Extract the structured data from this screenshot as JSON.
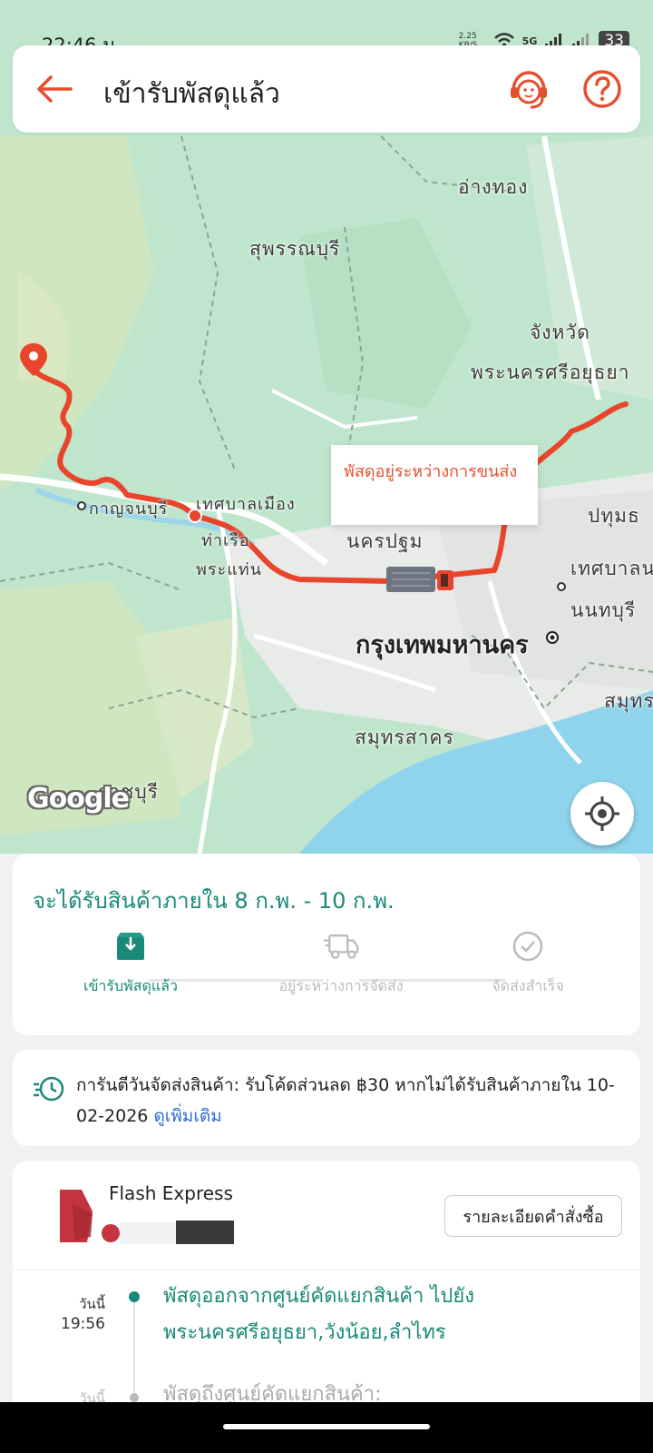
{
  "status_bar": {
    "time": "22:46 น.",
    "net_speed": "2.25 KB/S",
    "network": "5G",
    "battery": "33"
  },
  "header": {
    "title": "เข้ารับพัสดุแล้ว"
  },
  "map": {
    "labels": {
      "angthong": "อ่างทอง",
      "suphanburi": "สุพรรณบุรี",
      "changwat": "จังหวัด",
      "ayutthaya": "พระนครศรีอยุธยา",
      "kanchanaburi": "กาญจนบุรี",
      "thesaban_mueang": "เทศบาลเมือง",
      "tha_ruea": "ท่าเรือ",
      "phra_thaen": "พระแท่น",
      "nakhon_pathom": "นครปฐม",
      "pathum": "ปทุมธ",
      "thesaban_n": "เทศบาลน",
      "nonthaburi": "นนทบุรี",
      "bangkok": "กรุงเทพมหานคร",
      "samut": "สมุทร",
      "samut_sakhon": "สมุทรสาคร",
      "ratchaburi": "ราชบุรี"
    },
    "google_logo": "Google",
    "tooltip": "พัสดุอยู่ระหว่างการขนส่ง",
    "route_color": "#e8452c"
  },
  "delivery": {
    "eta": "จะได้รับสินค้าภายใน 8 ก.พ. - 10 ก.พ.",
    "steps": [
      {
        "label": "เข้ารับพัสดุแล้ว",
        "state": "active"
      },
      {
        "label": "อยู่ระหว่างการจัดส่ง",
        "state": "pending"
      },
      {
        "label": "จัดส่งสำเร็จ",
        "state": "pending"
      }
    ]
  },
  "guarantee": {
    "text": "การันตีวันจัดส่งสินค้า: รับโค้ดส่วนลด ฿30 หากไม่ได้รับสินค้าภายใน 10-02-2026",
    "link": "ดูเพิ่มเติม"
  },
  "tracking": {
    "courier": "Flash Express",
    "order_details_button": "รายละเอียดคำสั่งซื้อ",
    "events": [
      {
        "day": "วันนี้",
        "time": "19:56",
        "description": "พัสดุออกจากศูนย์คัดแยกสินค้า ไปยัง พระนครศรีอยุธยา,วังน้อย,ลำไทร",
        "state": "current"
      },
      {
        "day": "วันนี้",
        "time": "",
        "description": "พัสดุถึงศูนย์คัดแยกสินค้า:",
        "state": "past"
      }
    ]
  },
  "colors": {
    "accent": "#e4502f",
    "teal": "#1a8a78",
    "map_green": "#bfe6cd",
    "water": "#8fd3ec"
  }
}
